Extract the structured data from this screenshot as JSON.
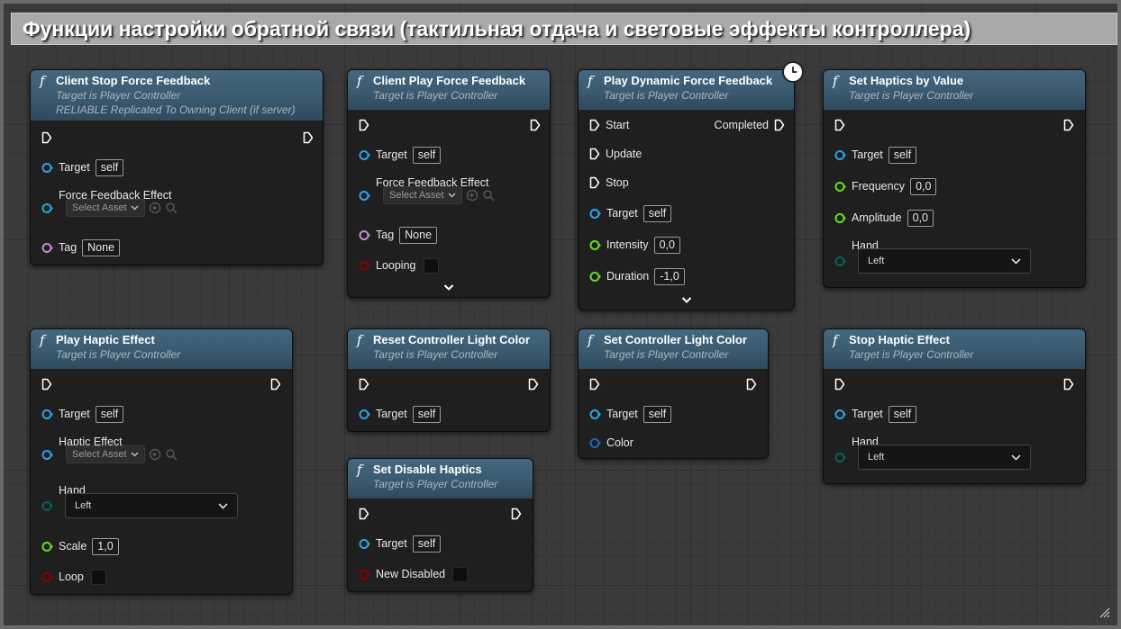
{
  "comment": {
    "title": "Функции настройки обратной связи (тактильная отдача и световые эффекты контроллера)"
  },
  "colors": {
    "exec": "#ffffff",
    "object_pin": "#2aa5e8",
    "float_pin": "#63e022",
    "name_pin": "#c78ad8",
    "bool_pin": "#8a0000",
    "enum_pin": "#05615b",
    "struct_pin": "#1c66c0",
    "header": "#3a5a70"
  },
  "icons": {
    "function": "f",
    "exec_in": "exec-arrow-icon",
    "exec_out": "exec-arrow-icon",
    "latent": "clock-icon",
    "expand": "chevron-down-icon",
    "dropdown": "chevron-down-icon"
  },
  "nodes": {
    "client_stop": {
      "title": "Client Stop Force Feedback",
      "sub1": "Target is Player Controller",
      "sub2": "RELIABLE Replicated To Owning Client (if server)",
      "target_label": "Target",
      "target_value": "self",
      "effect_label": "Force Feedback Effect",
      "effect_select": "Select Asset",
      "tag_label": "Tag",
      "tag_value": "None"
    },
    "client_play": {
      "title": "Client Play Force Feedback",
      "sub1": "Target is Player Controller",
      "target_label": "Target",
      "target_value": "self",
      "effect_label": "Force Feedback Effect",
      "effect_select": "Select Asset",
      "tag_label": "Tag",
      "tag_value": "None",
      "looping_label": "Looping"
    },
    "play_dynamic": {
      "title": "Play Dynamic Force Feedback",
      "sub1": "Target is Player Controller",
      "start_label": "Start",
      "completed_label": "Completed",
      "update_label": "Update",
      "stop_label": "Stop",
      "target_label": "Target",
      "target_value": "self",
      "intensity_label": "Intensity",
      "intensity_value": "0,0",
      "duration_label": "Duration",
      "duration_value": "-1,0"
    },
    "set_haptics": {
      "title": "Set Haptics by Value",
      "sub1": "Target is Player Controller",
      "target_label": "Target",
      "target_value": "self",
      "frequency_label": "Frequency",
      "frequency_value": "0,0",
      "amplitude_label": "Amplitude",
      "amplitude_value": "0,0",
      "hand_label": "Hand",
      "hand_value": "Left"
    },
    "play_haptic": {
      "title": "Play Haptic Effect",
      "sub1": "Target is Player Controller",
      "target_label": "Target",
      "target_value": "self",
      "effect_label": "Haptic Effect",
      "effect_select": "Select Asset",
      "hand_label": "Hand",
      "hand_value": "Left",
      "scale_label": "Scale",
      "scale_value": "1,0",
      "loop_label": "Loop"
    },
    "reset_light": {
      "title": "Reset Controller Light Color",
      "sub1": "Target is Player Controller",
      "target_label": "Target",
      "target_value": "self"
    },
    "set_light": {
      "title": "Set Controller Light Color",
      "sub1": "Target is Player Controller",
      "target_label": "Target",
      "target_value": "self",
      "color_label": "Color"
    },
    "stop_haptic": {
      "title": "Stop Haptic Effect",
      "sub1": "Target is Player Controller",
      "target_label": "Target",
      "target_value": "self",
      "hand_label": "Hand",
      "hand_value": "Left"
    },
    "disable_haptics": {
      "title": "Set Disable Haptics",
      "sub1": "Target is Player Controller",
      "target_label": "Target",
      "target_value": "self",
      "disabled_label": "New Disabled"
    }
  }
}
